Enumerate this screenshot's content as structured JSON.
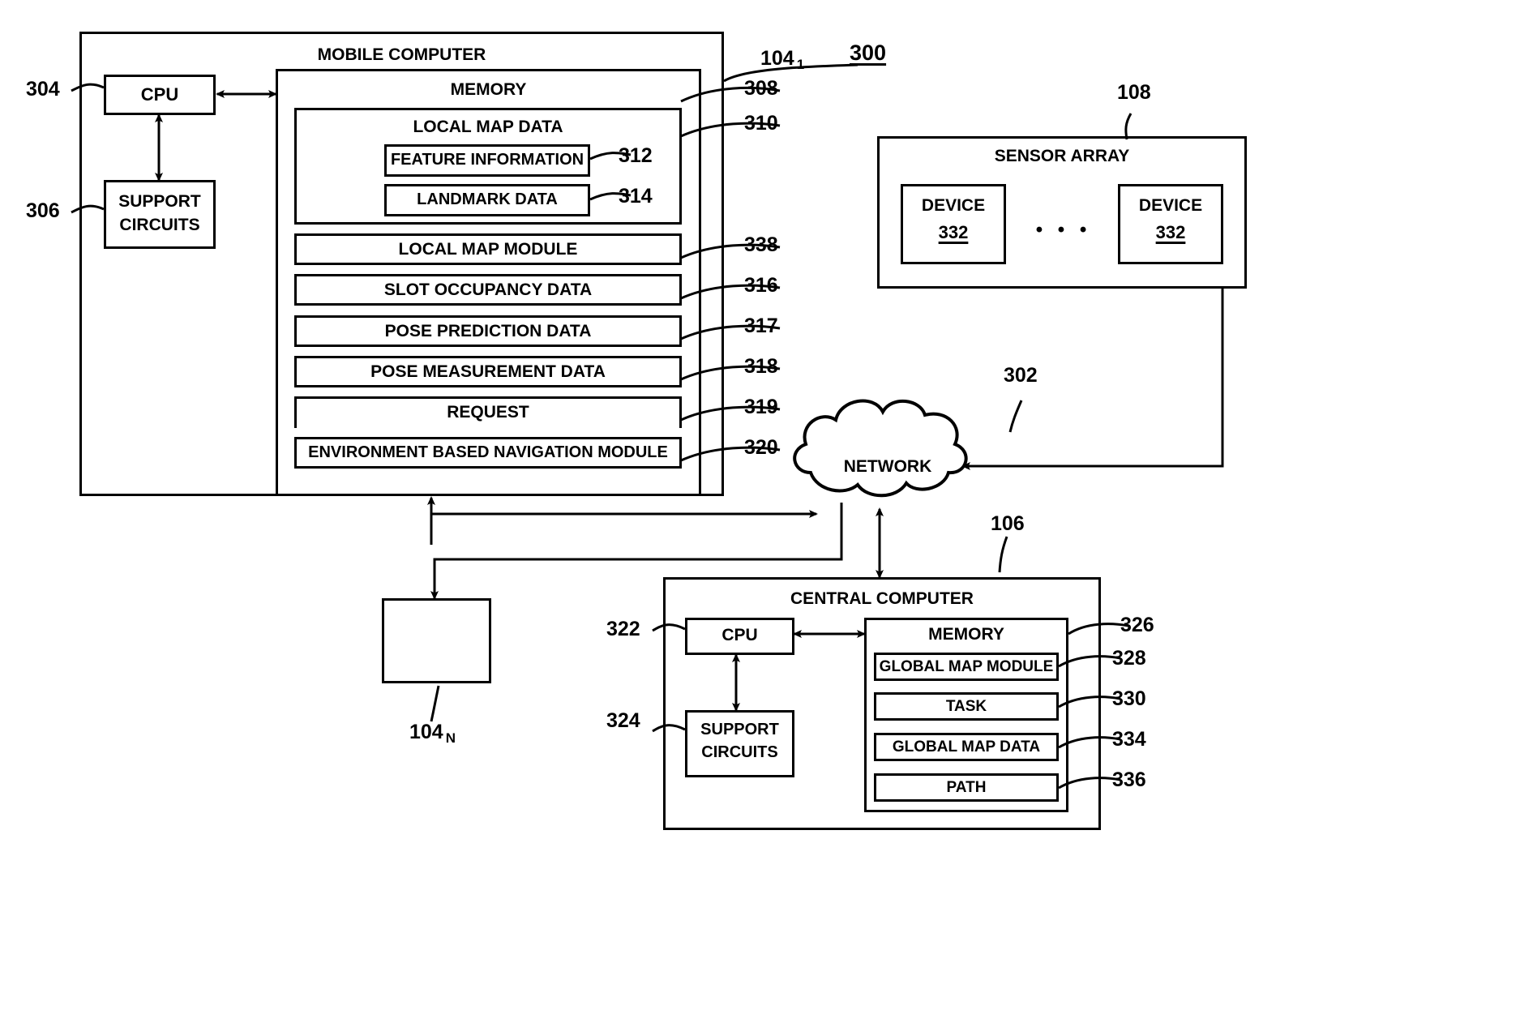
{
  "figure": {
    "number": "300"
  },
  "mobile_computer": {
    "title": "MOBILE COMPUTER",
    "ref": "104",
    "ref_sub": "1",
    "cpu": {
      "label": "CPU",
      "ref": "304"
    },
    "support_circuits": {
      "line1": "SUPPORT",
      "line2": "CIRCUITS",
      "ref": "306"
    },
    "memory": {
      "label": "MEMORY",
      "ref": "308",
      "local_map_data": {
        "label": "LOCAL MAP DATA",
        "ref": "310",
        "items": [
          {
            "label": "FEATURE INFORMATION",
            "ref": "312"
          },
          {
            "label": "LANDMARK DATA",
            "ref": "314"
          }
        ]
      },
      "items": [
        {
          "label": "LOCAL MAP MODULE",
          "ref": "338"
        },
        {
          "label": "SLOT OCCUPANCY DATA",
          "ref": "316"
        },
        {
          "label": "POSE PREDICTION DATA",
          "ref": "317"
        },
        {
          "label": "POSE MEASUREMENT DATA",
          "ref": "318"
        },
        {
          "label": "REQUEST",
          "ref": "319"
        },
        {
          "label": "ENVIRONMENT BASED NAVIGATION MODULE",
          "ref": "320"
        }
      ]
    }
  },
  "mobile_computer_n": {
    "ref": "104",
    "ref_sub": "N"
  },
  "sensor_array": {
    "title": "SENSOR ARRAY",
    "ref": "108",
    "devices": [
      {
        "label": "DEVICE",
        "ref": "332"
      },
      {
        "label": "DEVICE",
        "ref": "332"
      }
    ],
    "ellipsis": "• • •"
  },
  "network": {
    "label": "NETWORK",
    "ref": "302"
  },
  "central_computer": {
    "title": "CENTRAL COMPUTER",
    "ref": "106",
    "cpu": {
      "label": "CPU",
      "ref": "322"
    },
    "support_circuits": {
      "line1": "SUPPORT",
      "line2": "CIRCUITS",
      "ref": "324"
    },
    "memory": {
      "label": "MEMORY",
      "ref": "326",
      "items": [
        {
          "label": "GLOBAL MAP MODULE",
          "ref": "328"
        },
        {
          "label": "TASK",
          "ref": "330"
        },
        {
          "label": "GLOBAL MAP DATA",
          "ref": "334"
        },
        {
          "label": "PATH",
          "ref": "336"
        }
      ]
    }
  }
}
